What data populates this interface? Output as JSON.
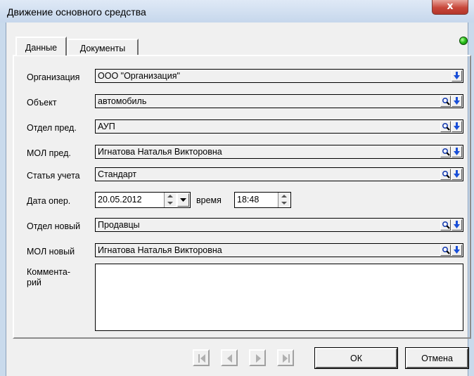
{
  "window": {
    "title": "Движение основного средства",
    "close_glyph": "x"
  },
  "tabs": [
    {
      "label": "Данные",
      "active": true
    },
    {
      "label": "Документы",
      "active": false
    }
  ],
  "status_indicator": {
    "color": "#29c01a"
  },
  "form": {
    "organization": {
      "label": "Организация",
      "value": "ООО \"Организация\""
    },
    "object": {
      "label": "Объект",
      "value": "автомобиль"
    },
    "dept_prev": {
      "label": "Отдел пред.",
      "value": "АУП"
    },
    "mol_prev": {
      "label": "МОЛ пред.",
      "value": "Игнатова Наталья Викторовна"
    },
    "account_item": {
      "label": "Статья учета",
      "value": "Стандарт"
    },
    "op_date": {
      "label": "Дата опер.",
      "value": "20.05.2012"
    },
    "time": {
      "label": "время",
      "value": "18:48"
    },
    "dept_new": {
      "label": "Отдел новый",
      "value": "Продавцы"
    },
    "mol_new": {
      "label": "МОЛ новый",
      "value": "Игнатова Наталья Викторовна"
    },
    "comment": {
      "label": "Коммента-\nрий",
      "value": ""
    }
  },
  "buttons": {
    "ok": "ОК",
    "cancel": "Отмена"
  },
  "icons": {
    "dropdown": "blue-down-arrow-icon",
    "search": "magnifier-icon",
    "nav": [
      "first-record-icon",
      "prev-record-icon",
      "next-record-icon",
      "last-record-icon"
    ]
  }
}
